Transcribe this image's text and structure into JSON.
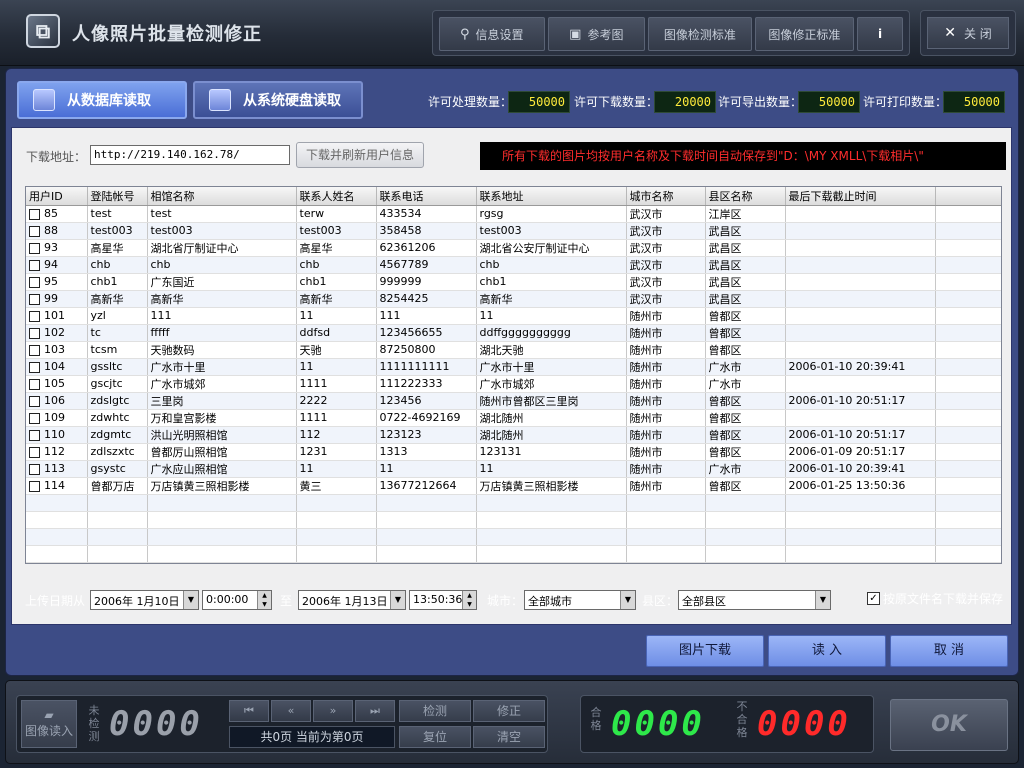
{
  "app": {
    "title": "人像照片批量检测修正"
  },
  "toolbar": {
    "info_settings": "信息设置",
    "reference": "参考图",
    "detect_std": "图像检测标准",
    "fix_std": "图像修正标准",
    "about": "i",
    "close": "关 闭"
  },
  "source": {
    "db": "从数据库读取",
    "disk": "从系统硬盘读取"
  },
  "permissions": [
    {
      "label": "许可处理数量：",
      "value": "50000"
    },
    {
      "label": "许可下载数量：",
      "value": "20000"
    },
    {
      "label": "许可导出数量：",
      "value": "50000"
    },
    {
      "label": "许可打印数量：",
      "value": "50000"
    }
  ],
  "download": {
    "label": "下载地址：",
    "url": "http://219.140.162.78/",
    "refresh_button": "下载并刷新用户信息",
    "notice": "所有下载的图片均按用户名称及下载时间自动保存到\"D：\\MY XMLL\\下载相片\\\""
  },
  "table": {
    "columns": [
      "用户ID",
      "登陆帐号",
      "相馆名称",
      "联系人姓名",
      "联系电话",
      "联系地址",
      "城市名称",
      "县区名称",
      "最后下载截止时间"
    ],
    "rows": [
      [
        "85",
        "test",
        "test",
        "terw",
        "433534",
        "rgsg",
        "武汉市",
        "江岸区",
        ""
      ],
      [
        "88",
        "test003",
        "test003",
        "test003",
        "358458",
        "test003",
        "武汉市",
        "武昌区",
        ""
      ],
      [
        "93",
        "高星华",
        "湖北省厅制证中心",
        "高星华",
        "62361206",
        "湖北省公安厅制证中心",
        "武汉市",
        "武昌区",
        ""
      ],
      [
        "94",
        "chb",
        "chb",
        "chb",
        "4567789",
        "chb",
        "武汉市",
        "武昌区",
        ""
      ],
      [
        "95",
        "chb1",
        "广东国近",
        "chb1",
        "999999",
        "chb1",
        "武汉市",
        "武昌区",
        ""
      ],
      [
        "99",
        "高新华",
        "高新华",
        "高新华",
        "8254425",
        "高新华",
        "武汉市",
        "武昌区",
        ""
      ],
      [
        "101",
        "yzl",
        "111",
        "11",
        "111",
        "11",
        "随州市",
        "曾都区",
        ""
      ],
      [
        "102",
        "tc",
        "fffff",
        "ddfsd",
        "123456655",
        "ddffgggggggggg",
        "随州市",
        "曾都区",
        ""
      ],
      [
        "103",
        "tcsm",
        "天驰数码",
        "天驰",
        "87250800",
        "湖北天驰",
        "随州市",
        "曾都区",
        ""
      ],
      [
        "104",
        "gssltc",
        "广水市十里",
        "11",
        "1111111111",
        "广水市十里",
        "随州市",
        "广水市",
        "2006-01-10 20:39:41"
      ],
      [
        "105",
        "gscjtc",
        "广水市城郊",
        "1111",
        "111222333",
        "广水市城郊",
        "随州市",
        "广水市",
        ""
      ],
      [
        "106",
        "zdslgtc",
        "三里岗",
        "2222",
        "123456",
        "随州市曾都区三里岗",
        "随州市",
        "曾都区",
        "2006-01-10 20:51:17"
      ],
      [
        "109",
        "zdwhtc",
        "万和皇宫影楼",
        "1111",
        "0722-4692169",
        "湖北随州",
        "随州市",
        "曾都区",
        ""
      ],
      [
        "110",
        "zdgmtc",
        "洪山光明照相馆",
        "112",
        "123123",
        "湖北随州",
        "随州市",
        "曾都区",
        "2006-01-10 20:51:17"
      ],
      [
        "112",
        "zdlszxtc",
        "曾都厉山照相馆",
        "1231",
        "1313",
        "123131",
        "随州市",
        "曾都区",
        "2006-01-09 20:51:17"
      ],
      [
        "113",
        "gsystc",
        "广水应山照相馆",
        "11",
        "11",
        "11",
        "随州市",
        "广水市",
        "2006-01-10 20:39:41"
      ],
      [
        "114",
        "曾都万店",
        "万店镇黄三照相影楼",
        "黄三",
        "13677212664",
        "万店镇黄三照相影楼",
        "随州市",
        "曾都区",
        "2006-01-25 13:50:36"
      ]
    ]
  },
  "filter": {
    "upload_date_label": "上传日期从",
    "from_date": "2006年 1月10日",
    "from_time": "0:00:00",
    "to_label": "至",
    "to_date": "2006年 1月13日",
    "to_time": "13:50:36",
    "city_label": "城市：",
    "city_value": "全部城市",
    "county_label": "县区：",
    "county_value": "全部县区",
    "keep_name_label": "按原文件名下载并保存"
  },
  "actions": {
    "download": "图片下载",
    "read": "读  入",
    "cancel": "取  消"
  },
  "bottom": {
    "load_images": "图像读入",
    "undetected_label": "未检测",
    "undetected_count": "0000",
    "page_info": "共0页 当前为第0页",
    "detect": "检测",
    "fix": "修正",
    "reset": "复位",
    "clear": "清空",
    "pass_label": "合格",
    "pass_count": "0000",
    "fail_label": "不合格",
    "fail_count": "0000",
    "ok": "OK"
  }
}
